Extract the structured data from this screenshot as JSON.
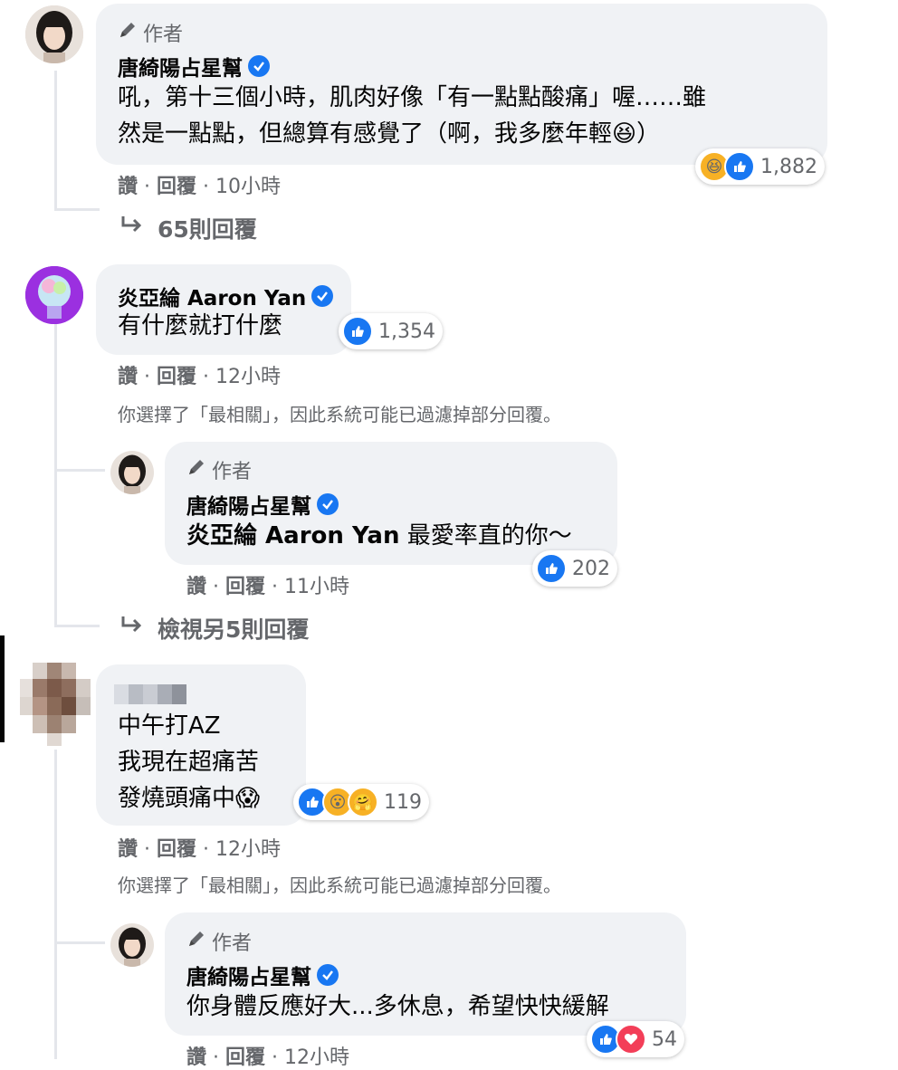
{
  "comments": [
    {
      "author_badge": "作者",
      "name": "唐綺陽占星幫",
      "text_lines": [
        "吼，第十三個小時，肌肉好像「有一點點酸痛」喔……雖",
        "然是一點點，但總算有感覺了（啊，我多麼年輕😆）"
      ],
      "reactions": [
        "laugh",
        "like"
      ],
      "reaction_count": "1,882",
      "like_label": "讚",
      "reply_label": "回覆",
      "time": "10小時",
      "view_replies": "65則回覆"
    },
    {
      "name": "炎亞綸 Aaron Yan",
      "text_lines": [
        "有什麼就打什麼"
      ],
      "reactions": [
        "like"
      ],
      "reaction_count": "1,354",
      "like_label": "讚",
      "reply_label": "回覆",
      "time": "12小時",
      "notice": "你選擇了「最相關」，因此系統可能已過濾掉部分回覆。",
      "reply": {
        "author_badge": "作者",
        "name": "唐綺陽占星幫",
        "mention": "炎亞綸 Aaron Yan",
        "text": " 最愛率直的你～",
        "reactions": [
          "like"
        ],
        "reaction_count": "202",
        "like_label": "讚",
        "reply_label": "回覆",
        "time": "11小時"
      },
      "view_replies": "檢視另5則回覆"
    },
    {
      "name": "",
      "text_lines": [
        "中午打AZ",
        "我現在超痛苦",
        "發燒頭痛中😱"
      ],
      "reactions": [
        "like",
        "wow",
        "care"
      ],
      "reaction_count": "119",
      "like_label": "讚",
      "reply_label": "回覆",
      "time": "12小時",
      "notice": "你選擇了「最相關」，因此系統可能已過濾掉部分回覆。",
      "reply": {
        "author_badge": "作者",
        "name": "唐綺陽占星幫",
        "text": "你身體反應好大...多休息，希望快快緩解",
        "reactions": [
          "like",
          "heart"
        ],
        "reaction_count": "54",
        "like_label": "讚",
        "reply_label": "回覆",
        "time": "12小時"
      }
    }
  ],
  "separator": "·",
  "colors": {
    "accent": "#1877f2",
    "bubble": "#f0f2f5",
    "meta": "#65676b",
    "line": "#e4e6eb"
  }
}
